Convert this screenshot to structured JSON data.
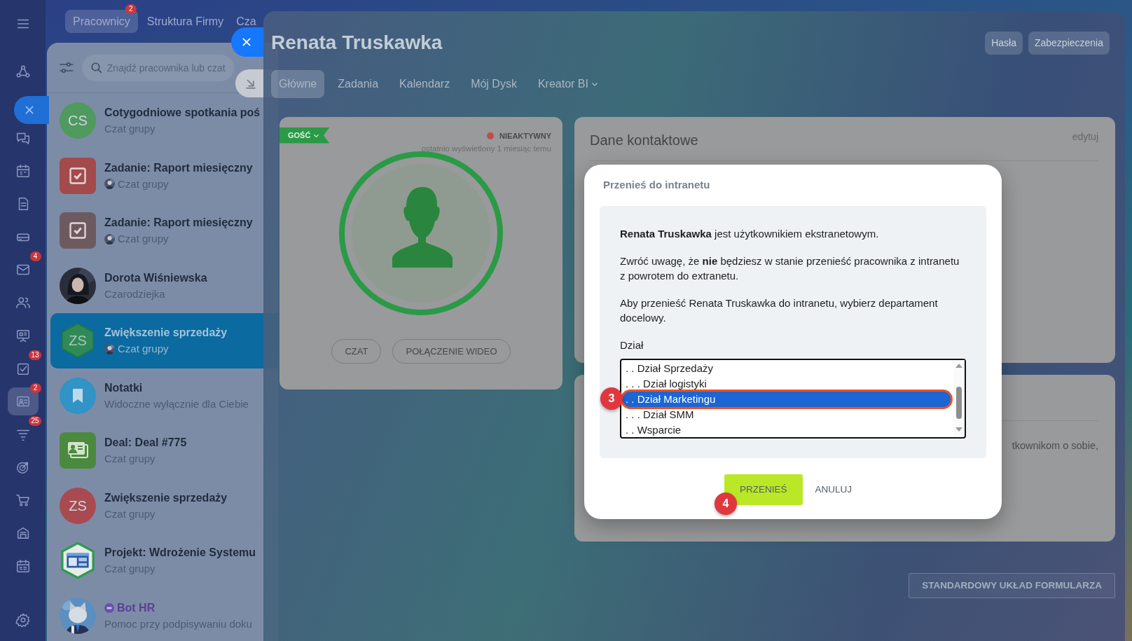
{
  "rail": {
    "items": [
      {
        "selected": false
      },
      {
        "selected": false
      },
      {
        "selected": false
      },
      {
        "selected": false
      },
      {
        "selected": false
      },
      {
        "selected": false,
        "badge": "4"
      },
      {
        "selected": false
      },
      {
        "selected": false
      },
      {
        "selected": false,
        "badge": "13"
      },
      {
        "selected": true,
        "badge": "2"
      },
      {
        "selected": false,
        "badge": "25"
      },
      {
        "selected": false
      },
      {
        "selected": false
      },
      {
        "selected": false
      },
      {
        "selected": false
      }
    ]
  },
  "top_tabs": [
    {
      "label": "Pracownicy",
      "selected": true,
      "badge": "2"
    },
    {
      "label": "Struktura Firmy",
      "selected": false
    },
    {
      "label": "Cza",
      "selected": false
    }
  ],
  "chat_list": {
    "search": {
      "placeholder": "Znajdź pracownika lub czat"
    },
    "rows": [
      {
        "title": "Cotygodniowe spotkania poś",
        "subtitle": "Czat grupy",
        "selected": false,
        "avatar": {
          "kind": "initials",
          "initials": "CS",
          "color": "#4f9a5e"
        }
      },
      {
        "title": "Zadanie: Raport miesięczny",
        "subtitle": "Czat grupy",
        "selected": false,
        "sub_photo": true,
        "avatar": {
          "kind": "task",
          "color": "#a34a4c"
        }
      },
      {
        "title": "Zadanie: Raport miesięczny",
        "subtitle": "Czat grupy",
        "selected": false,
        "sub_photo": true,
        "avatar": {
          "kind": "task",
          "color": "#6d5a61"
        }
      },
      {
        "title": "Dorota Wiśniewska",
        "subtitle": "Czarodziejka",
        "selected": false
      },
      {
        "title": "Zwiększenie sprzedaży",
        "subtitle": "Czat grupy",
        "selected": true,
        "sub_photo": true,
        "avatar": {
          "kind": "hex",
          "initials": "ZS",
          "color": "#2f8a58"
        }
      },
      {
        "title": "Notatki",
        "subtitle": "Widoczne wyłącznie dla Ciebie",
        "selected": false,
        "avatar": {
          "kind": "bookmark",
          "color": "#3193c6"
        }
      },
      {
        "title": "Deal: Deal #775",
        "subtitle": "Czat grupy",
        "selected": false,
        "avatar": {
          "kind": "deal",
          "color": "#4b8a3e"
        }
      },
      {
        "title": "Zwiększenie sprzedaży",
        "subtitle": "Czat grupy",
        "selected": false,
        "avatar": {
          "kind": "initials",
          "initials": "ZS",
          "color": "#a84b50"
        }
      },
      {
        "title": "Projekt: Wdrożenie Systemu",
        "subtitle": "Czat grupy",
        "selected": false,
        "avatar": {
          "kind": "project"
        }
      },
      {
        "title": "Bot HR",
        "subtitle": "Pomoc przy podpisywaniu doku",
        "selected": false,
        "bot": true
      }
    ]
  },
  "profile": {
    "title": "Renata Truskawka",
    "header_buttons": [
      "Hasła",
      "Zabezpieczenia"
    ],
    "tabs": [
      {
        "label": "Główne",
        "selected": true
      },
      {
        "label": "Zadania",
        "selected": false
      },
      {
        "label": "Kalendarz",
        "selected": false
      },
      {
        "label": "Mój Dysk",
        "selected": false
      },
      {
        "label": "Kreator BI",
        "selected": false,
        "dropdown": true
      }
    ],
    "card": {
      "role": "GOŚĆ",
      "status": "NIEAKTYWNY",
      "last_seen": "ostatnio wyświetlony 1 miesiąc temu",
      "buttons": [
        "CZAT",
        "POŁĄCZENIE WIDEO"
      ]
    },
    "contact": {
      "title": "Dane kontaktowe",
      "edit": "edytuj"
    },
    "about": {
      "text": "tkownikom o sobie,"
    },
    "layout_button": "STANDARDOWY UKŁAD FORMULARZA"
  },
  "dialog": {
    "title": "Przenieś do intranetu",
    "paragraphs": [
      "**Renata Truskawka** jest użytkownikiem ekstranetowym.",
      "Zwróć uwagę, że **nie** będziesz w stanie przenieść pracownika z intranetu z powrotem do extranetu.",
      "Aby przenieść Renata Truskawka do intranetu, wybierz departament docelowy."
    ],
    "field_label": "Dział",
    "options": [
      {
        "label": ". . Dział Sprzedaży",
        "selected": false
      },
      {
        "label": ". . . Dział logistyki",
        "selected": false
      },
      {
        "label": ". . Dział Marketingu",
        "selected": true,
        "step": "3"
      },
      {
        "label": ". . . Dział SMM",
        "selected": false
      },
      {
        "label": ". . Wsparcie",
        "selected": false
      }
    ],
    "buttons": [
      {
        "label": "PRZENIEŚ",
        "kind": "primary",
        "step": "4"
      },
      {
        "label": "ANULUJ",
        "kind": "link"
      }
    ]
  }
}
